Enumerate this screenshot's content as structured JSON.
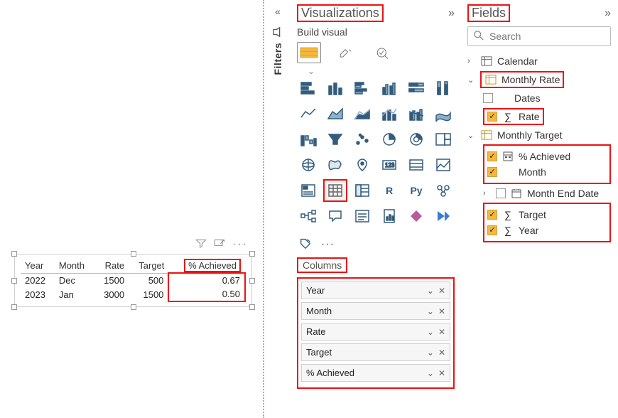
{
  "filters": {
    "label": "Filters"
  },
  "viz_panel": {
    "title": "Visualizations",
    "subhead": "Build visual"
  },
  "fields_panel": {
    "title": "Fields",
    "search_placeholder": "Search"
  },
  "columns": {
    "label": "Columns",
    "items": [
      "Year",
      "Month",
      "Rate",
      "Target",
      "% Achieved"
    ]
  },
  "tables": {
    "calendar": {
      "name": "Calendar"
    },
    "monthly_rate": {
      "name": "Monthly Rate",
      "fields": {
        "dates": {
          "name": "Dates",
          "checked": false
        },
        "rate": {
          "name": "Rate",
          "checked": true,
          "sigma": true
        }
      }
    },
    "monthly_target": {
      "name": "Monthly Target",
      "fields": {
        "pct_achieved": {
          "name": "% Achieved",
          "checked": true,
          "calc": true
        },
        "month": {
          "name": "Month",
          "checked": true
        },
        "month_end_date": {
          "name": "Month End Date",
          "checked": false,
          "date": true
        },
        "target": {
          "name": "Target",
          "checked": true,
          "sigma": true
        },
        "year": {
          "name": "Year",
          "checked": true,
          "sigma": true
        }
      }
    }
  },
  "table_visual": {
    "headers": [
      "Year",
      "Month",
      "Rate",
      "Target",
      "% Achieved"
    ],
    "rows": [
      {
        "year": "2022",
        "month": "Dec",
        "rate": "1500",
        "target": "500",
        "achieved": "0.67"
      },
      {
        "year": "2023",
        "month": "Jan",
        "rate": "3000",
        "target": "1500",
        "achieved": "0.50"
      }
    ]
  },
  "viz_icons_row5": {
    "r_label": "R",
    "py_label": "Py"
  }
}
